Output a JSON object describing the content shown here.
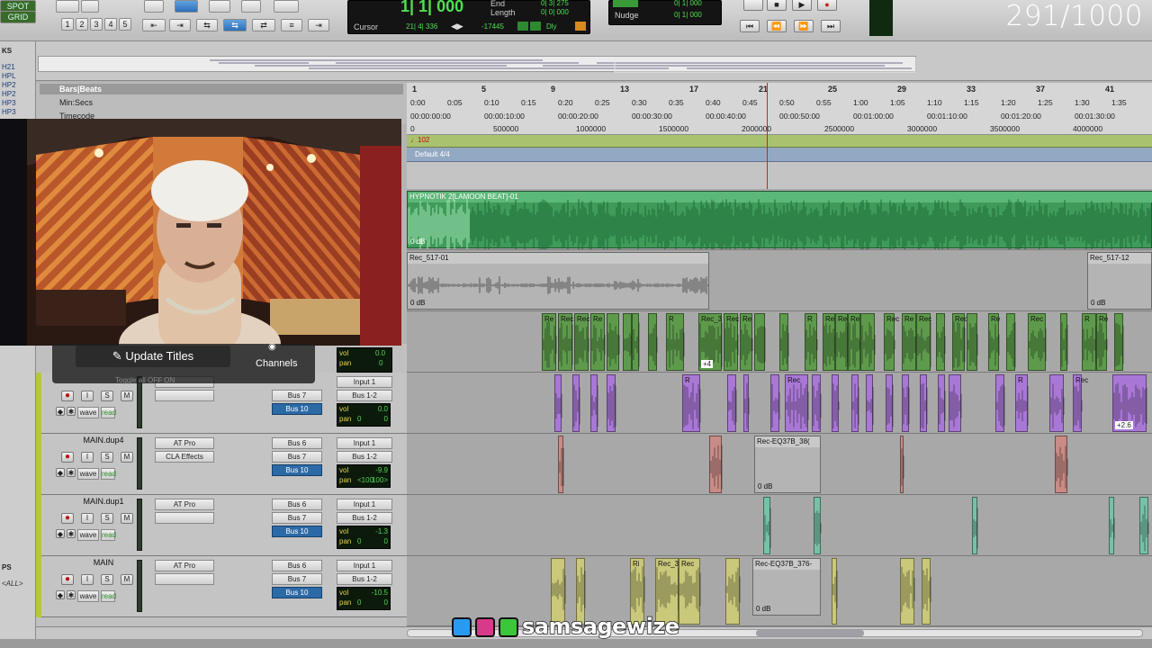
{
  "toolbar": {
    "mode_top": "SPOT",
    "mode_bottom": "GRID",
    "zoom_presets": [
      "1",
      "2",
      "3",
      "4",
      "5"
    ],
    "counter": {
      "main": "1| 1| 000",
      "end_label": "End",
      "length_label": "Length",
      "end_val": "0| 3| 275",
      "length_val": "0| 0| 000",
      "cursor_label": "Cursor",
      "cursor_val": "21| 4| 336",
      "cursor_sample": "-17445",
      "dly": "Dly"
    },
    "nudge": {
      "grid_val": "0| 1| 000",
      "nudge_label": "Nudge",
      "nudge_val": "0| 1| 000"
    },
    "frame_counter": "291/1000"
  },
  "left_column": {
    "tabs": [
      "KS",
      "H21",
      "HPL",
      "HP2",
      "HP2",
      "HP3",
      "HP3"
    ],
    "group_label": "PS",
    "all_label": "<ALL>"
  },
  "rulers": {
    "labels": [
      "Bars|Beats",
      "Min:Secs",
      "Timecode"
    ],
    "bars": [
      "1",
      "5",
      "9",
      "13",
      "17",
      "21",
      "25",
      "29",
      "33",
      "37",
      "41"
    ],
    "minsecs": [
      "0:00",
      "0:05",
      "0:10",
      "0:15",
      "0:20",
      "0:25",
      "0:30",
      "0:35",
      "0:40",
      "0:45",
      "0:50",
      "0:55",
      "1:00",
      "1:05",
      "1:10",
      "1:15",
      "1:20",
      "1:25",
      "1:30",
      "1:35"
    ],
    "timecode": [
      "00:00:00:00",
      "00:00:10:00",
      "00:00:20:00",
      "00:00:30:00",
      "00:00:40:00",
      "00:00:50:00",
      "00:01:00:00",
      "00:01:10:00",
      "00:01:20:00",
      "00:01:30:00"
    ],
    "samples": [
      "0",
      "500000",
      "1000000",
      "1500000",
      "2000000",
      "2500000",
      "3000000",
      "3500000",
      "4000000"
    ],
    "tempo": "♩102",
    "meter": "Default 4/4"
  },
  "tracks_regions": {
    "beat": {
      "name": "HYPNOTIK 2[LAMOON BEAT]-01",
      "gain": "0 dB"
    },
    "rec1": {
      "name": "Rec_517-01",
      "gain": "0 dB",
      "right_name": "Rec_517-12",
      "right_gain": "0 dB"
    },
    "vox_labels": [
      "Re",
      "Rec",
      "Rec",
      "Re",
      "R",
      "Rec_3",
      "Rec",
      "Re",
      "R",
      "Re",
      "Rec",
      "Re",
      "Rec",
      "Rec",
      "Re",
      "Re",
      "Rec",
      "R",
      "Re"
    ],
    "vox_extra": "+4",
    "purple_labels": [
      "R",
      "Rec",
      "R",
      "Rec",
      "Rec_51"
    ],
    "purple_extra": "+2.6",
    "eq1": {
      "name": "Rec-EQ37B_38(",
      "gain": "0 dB"
    },
    "eq2": {
      "name": "Rec-EQ37B_376-",
      "gain": "0 dB"
    },
    "yellow_labels": [
      "Ri",
      "Rec_3",
      "Rec"
    ]
  },
  "webcam_overlay": {
    "update_titles": "Update Titles",
    "channels": "Channels",
    "toggle_hint": "Toggle all  OFF  ON"
  },
  "tracks": [
    {
      "name": "",
      "inserts": [],
      "sends": [
        "Bus 7",
        "Bus 10"
      ],
      "io_in": "Input 1",
      "io_out": "Bus 1-2",
      "vol": "0.0",
      "pan_l": "0",
      "pan_r": "0",
      "mode": "wave",
      "color": "#b6c83a"
    },
    {
      "name": "MAIN.dup4",
      "inserts": [
        "AT Pro",
        "CLA Effects"
      ],
      "sends": [
        "Bus 6",
        "Bus 7",
        "Bus 10"
      ],
      "io_in": "Input 1",
      "io_out": "Bus 1-2",
      "vol": "-9.9",
      "pan_l": "<100",
      "pan_r": "100>",
      "mode": "wave",
      "color": "#b6c83a"
    },
    {
      "name": "MAIN.dup1",
      "inserts": [
        "AT Pro"
      ],
      "sends": [
        "Bus 6",
        "Bus 7",
        "Bus 10"
      ],
      "io_in": "Input 1",
      "io_out": "Bus 1-2",
      "vol": "-1.3",
      "pan_l": "0",
      "pan_r": "0",
      "mode": "wave",
      "color": "#b6c83a"
    },
    {
      "name": "MAIN",
      "inserts": [
        "AT Pro"
      ],
      "sends": [
        "Bus 6",
        "Bus 7",
        "Bus 10"
      ],
      "io_in": "Input 1",
      "io_out": "Bus 1-2",
      "vol": "-10.5",
      "pan_l": "0",
      "pan_r": "0",
      "mode": "wave",
      "color": "#b6c83a"
    }
  ],
  "top_track": {
    "vol": "0.0",
    "pan": "0"
  },
  "track_buttons": {
    "mute": "M",
    "solo": "S",
    "input": "I",
    "vol_label": "vol",
    "pan_label": "pan",
    "read": "read"
  },
  "brand": {
    "handle": "samsagewize"
  },
  "colors": {
    "beat": "#3f9b5a",
    "vox": "#5e9a4c",
    "purple": "#a978d6",
    "red": "#c98b86",
    "cyan": "#77c2a7",
    "yellow": "#c9c87b",
    "tempo": "#a9c26f",
    "meter": "#93a9c3",
    "playhead": "#d32020"
  }
}
